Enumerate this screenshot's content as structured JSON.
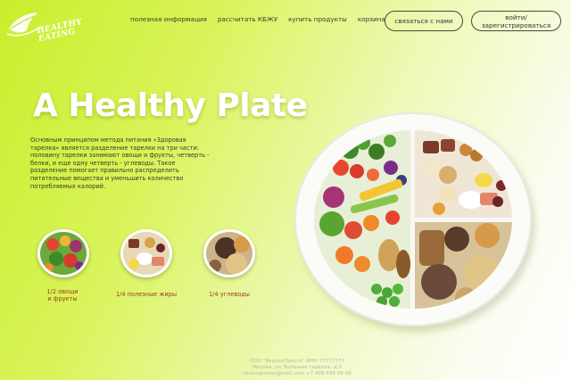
{
  "logo": {
    "text": "HEALTHY\nEATING"
  },
  "nav": {
    "items": [
      {
        "label": "полезная информация"
      },
      {
        "label": "рассчитать КБЖУ"
      },
      {
        "label": "купить продукты"
      },
      {
        "label": "корзина"
      }
    ],
    "contact_label": "связаться с нами",
    "login_label": "войти/зарегистрироваться"
  },
  "hero": {
    "title": "A Healthy Plate",
    "description": "Основным принципом метода питания «Здоровая тарелка» является разделение тарелки на три части: половину тарелки занимают овощи и фрукты, четверть - белки, и еще одну четверть - углеводы. Такое разделение помогает правильно распределить питательные вещества и уменьшить количество потребляемых калорий."
  },
  "portions": [
    {
      "label": "1/2 овощи\nи фрукты",
      "icon": "vegetables-photo"
    },
    {
      "label": "1/4 полезные жиры",
      "icon": "proteins-photo"
    },
    {
      "label": "1/4 углеводы",
      "icon": "grains-photo"
    }
  ],
  "footer": {
    "line1": "ООО \"ВкусноПросто\" ИНН 77777777",
    "line2": "Москва, ул. Большая тарелка, д.5",
    "line3": "vkusnoprosto@mail.com +7 499 999 99 99"
  },
  "colors": {
    "accent": "#c9ee2c",
    "title": "#ffffff",
    "portion_label": "#9a3a2a"
  }
}
